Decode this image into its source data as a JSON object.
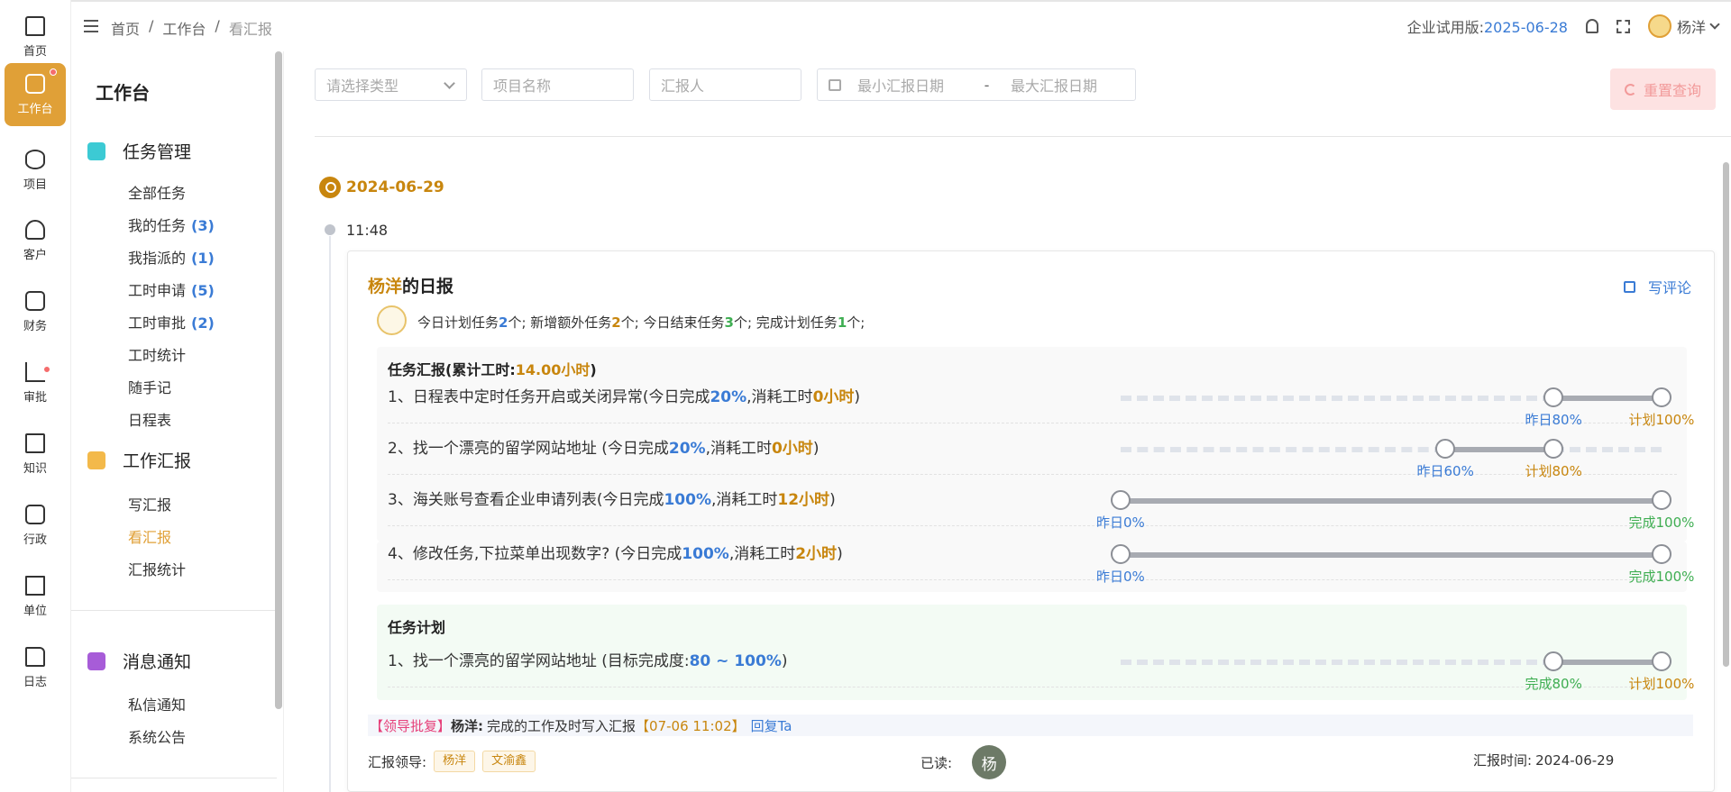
{
  "rail": {
    "items": [
      {
        "label": "首页",
        "icon": "home-icon"
      },
      {
        "label": "工作台",
        "icon": "monitor-icon"
      },
      {
        "label": "项目",
        "icon": "database-icon"
      },
      {
        "label": "客户",
        "icon": "user-icon"
      },
      {
        "label": "财务",
        "icon": "finance-icon"
      },
      {
        "label": "审批",
        "icon": "approve-icon"
      },
      {
        "label": "知识",
        "icon": "book-icon"
      },
      {
        "label": "行政",
        "icon": "briefcase-icon"
      },
      {
        "label": "单位",
        "icon": "building-icon"
      },
      {
        "label": "日志",
        "icon": "document-icon"
      }
    ]
  },
  "header": {
    "breadcrumb": [
      "首页",
      "/",
      "工作台",
      "/",
      "看汇报"
    ],
    "trial_label": "企业试用版:",
    "trial_date": "2025-06-28",
    "username": "杨洋"
  },
  "sidebar": {
    "title": "工作台",
    "groups": [
      {
        "label": "任务管理",
        "icon": "grid-icon"
      },
      {
        "label": "工作汇报",
        "icon": "note-edit-icon"
      },
      {
        "label": "消息通知",
        "icon": "message-icon"
      }
    ],
    "task_items": [
      {
        "label": "全部任务",
        "count": ""
      },
      {
        "label": "我的任务",
        "count": "(3)"
      },
      {
        "label": "我指派的",
        "count": "(1)"
      },
      {
        "label": "工时申请",
        "count": "(5)"
      },
      {
        "label": "工时审批",
        "count": "(2)"
      },
      {
        "label": "工时统计",
        "count": ""
      },
      {
        "label": "随手记",
        "count": ""
      },
      {
        "label": "日程表",
        "count": ""
      }
    ],
    "report_items": [
      "写汇报",
      "看汇报",
      "汇报统计"
    ],
    "message_items": [
      "私信通知",
      "系统公告"
    ]
  },
  "filters": {
    "type_placeholder": "请选择类型",
    "project_placeholder": "项目名称",
    "reporter_placeholder": "汇报人",
    "date_min_placeholder": "最小汇报日期",
    "date_sep": "-",
    "date_max_placeholder": "最大汇报日期",
    "reset_label": "重置查询"
  },
  "timeline": {
    "date": "2024-06-29",
    "time": "11:48"
  },
  "report": {
    "author": "杨洋",
    "title_suffix": "的日报",
    "comment_label": "写评论",
    "summary": {
      "p1": "今日计划任务",
      "n1": "2",
      "p2": "个; 新增额外任务",
      "n2": "2",
      "p3": "个; 今日结束任务",
      "n3": "3",
      "p4": "个; 完成计划任务",
      "n4": "1",
      "p5": "个;"
    },
    "tasks_header": "任务汇报(累计工时:",
    "tasks_hours": "14.00小时",
    "tasks_header_end": ")",
    "tasks": [
      {
        "title": "1、日程表中定时任务开启或关闭异常(今日完成",
        "pct": "20%",
        "mid": ",消耗工时",
        "hours": "0小时",
        "end": ")",
        "from": 80,
        "to": 100,
        "left_label": "昨日80%",
        "right_label": "计划100%"
      },
      {
        "title": "2、找一个漂亮的留学网站地址 (今日完成",
        "pct": "20%",
        "mid": ",消耗工时",
        "hours": "0小时",
        "end": ")",
        "from": 60,
        "to": 80,
        "left_label": "昨日60%",
        "right_label": "计划80%"
      },
      {
        "title": "3、海关账号查看企业申请列表(今日完成",
        "pct": "100%",
        "mid": ",消耗工时",
        "hours": "12小时",
        "end": ")",
        "from": 0,
        "to": 100,
        "left_label": "昨日0%",
        "right_label": "完成100%"
      },
      {
        "title": "4、修改任务,下拉菜单出现数字? (今日完成",
        "pct": "100%",
        "mid": ",消耗工时",
        "hours": "2小时",
        "end": ")",
        "from": 0,
        "to": 100,
        "left_label": "昨日0%",
        "right_label": "完成100%"
      }
    ],
    "plan_header": "任务计划",
    "plan": [
      {
        "title": "1、找一个漂亮的留学网站地址 (目标完成度:",
        "range": "80 ~ 100%",
        "end": ")",
        "from": 80,
        "to": 100,
        "left_label": "完成80%",
        "right_label": "计划100%"
      }
    ],
    "approval": {
      "tag": "【领导批复】",
      "name": "杨洋:",
      "text": "完成的工作及时写入汇报",
      "time": "【07-06 11:02】",
      "reply": "回复Ta"
    },
    "leaders_label": "汇报领导:",
    "leaders": [
      "杨洋",
      "文渝鑫"
    ],
    "read_label": "已读:",
    "reader_initial": "杨",
    "report_time_label": "汇报时间:",
    "report_time": "2024-06-29"
  },
  "colors": {
    "accent": "#e0a037",
    "link": "#3a7bd5",
    "success": "#3fae52",
    "danger": "#e6407a"
  }
}
